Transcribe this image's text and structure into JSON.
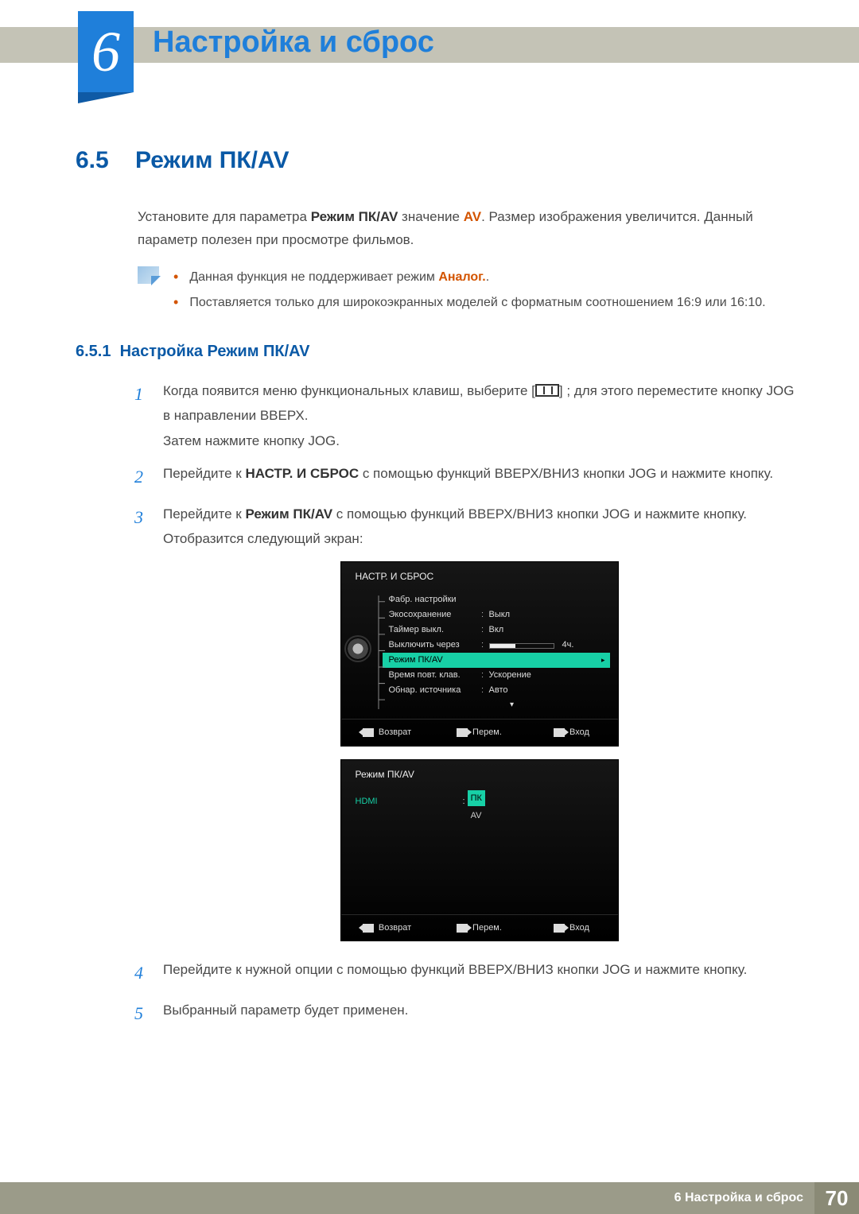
{
  "chapter": {
    "number": "6",
    "title": "Настройка и сброс"
  },
  "section": {
    "number": "6.5",
    "title": "Режим ПК/AV"
  },
  "intro": {
    "pre": "Установите для параметра ",
    "param": "Режим ПК/AV",
    "mid": " значение ",
    "value": "AV",
    "post": ". Размер изображения увеличится. Данный параметр полезен при просмотре фильмов."
  },
  "notes": {
    "n1_pre": "Данная функция не поддерживает режим ",
    "n1_em": "Аналог.",
    "n1_post": ".",
    "n2": "Поставляется только для широкоэкранных моделей с форматным соотношением 16:9 или 16:10."
  },
  "subsection": {
    "number": "6.5.1",
    "title": "Настройка Режим ПК/AV"
  },
  "steps": {
    "s1a": "Когда появится меню функциональных клавиш, выберите [",
    "s1b": "] ; для этого переместите кнопку JOG в направлении ВВЕРХ.",
    "s1c": "Затем нажмите кнопку JOG.",
    "s2a": "Перейдите к ",
    "s2em": "НАСТР. И СБРОС",
    "s2b": " с помощью функций ВВЕРХ/ВНИЗ кнопки JOG и нажмите кнопку.",
    "s3a": "Перейдите к ",
    "s3em": "Режим ПК/AV",
    "s3b": " с помощью функций ВВЕРХ/ВНИЗ кнопки JOG и нажмите кнопку.",
    "s3c": "Отобразится следующий экран:",
    "s4": "Перейдите к нужной опции с помощью функций ВВЕРХ/ВНИЗ кнопки JOG и нажмите кнопку.",
    "s5": "Выбранный параметр будет применен.",
    "n1": "1",
    "n2": "2",
    "n3": "3",
    "n4": "4",
    "n5": "5"
  },
  "osd1": {
    "title": "НАСТР. И СБРОС",
    "rows": [
      {
        "label": "Фабр. настройки",
        "value": ""
      },
      {
        "label": "Экосохранение",
        "value": "Выкл"
      },
      {
        "label": "Таймер выкл.",
        "value": "Вкл"
      },
      {
        "label": "Выключить через",
        "slider_text": "4ч."
      },
      {
        "label": "Режим ПК/AV",
        "value": "",
        "selected": true
      },
      {
        "label": "Время повт. клав.",
        "value": "Ускорение"
      },
      {
        "label": "Обнар. источника",
        "value": "Авто"
      }
    ],
    "foot": {
      "back": "Возврат",
      "move": "Перем.",
      "enter": "Вход"
    }
  },
  "osd2": {
    "title": "Режим ПК/AV",
    "source": "HDMI",
    "colon": ":",
    "opt_sel": "ПК",
    "opt_other": "AV",
    "foot": {
      "back": "Возврат",
      "move": "Перем.",
      "enter": "Вход"
    }
  },
  "footer": {
    "label": "6 Настройка и сброс",
    "page": "70"
  }
}
